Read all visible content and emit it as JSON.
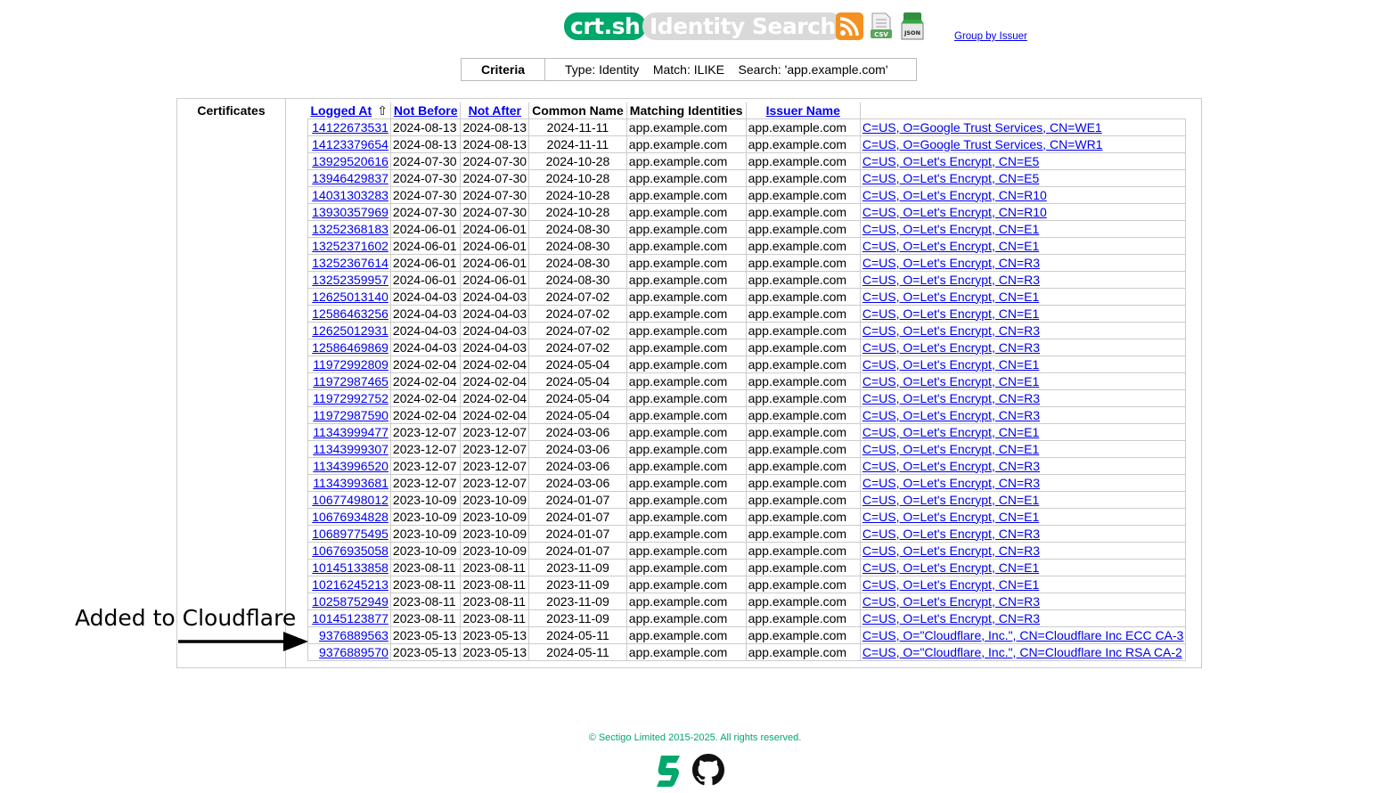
{
  "header": {
    "brand": "crt.sh",
    "subtitle": "Identity Search",
    "group_link": "Group by Issuer",
    "icons": [
      "rss-feed-icon",
      "csv-icon",
      "json-icon"
    ]
  },
  "criteria": {
    "label": "Criteria",
    "text": "Type: Identity    Match: ILIKE    Search: 'app.example.com'"
  },
  "results": {
    "section_label": "Certificates",
    "columns": [
      "Logged At",
      "Not Before",
      "Not After",
      "Common Name",
      "Matching Identities",
      "Issuer Name"
    ],
    "sort_arrow": "⇧",
    "rows": [
      [
        "14122673531",
        "2024-08-13",
        "2024-08-13",
        "2024-11-11",
        "app.example.com",
        "app.example.com",
        "C=US, O=Google Trust Services, CN=WE1"
      ],
      [
        "14123379654",
        "2024-08-13",
        "2024-08-13",
        "2024-11-11",
        "app.example.com",
        "app.example.com",
        "C=US, O=Google Trust Services, CN=WR1"
      ],
      [
        "13929520616",
        "2024-07-30",
        "2024-07-30",
        "2024-10-28",
        "app.example.com",
        "app.example.com",
        "C=US, O=Let's Encrypt, CN=E5"
      ],
      [
        "13946429837",
        "2024-07-30",
        "2024-07-30",
        "2024-10-28",
        "app.example.com",
        "app.example.com",
        "C=US, O=Let's Encrypt, CN=E5"
      ],
      [
        "14031303283",
        "2024-07-30",
        "2024-07-30",
        "2024-10-28",
        "app.example.com",
        "app.example.com",
        "C=US, O=Let's Encrypt, CN=R10"
      ],
      [
        "13930357969",
        "2024-07-30",
        "2024-07-30",
        "2024-10-28",
        "app.example.com",
        "app.example.com",
        "C=US, O=Let's Encrypt, CN=R10"
      ],
      [
        "13252368183",
        "2024-06-01",
        "2024-06-01",
        "2024-08-30",
        "app.example.com",
        "app.example.com",
        "C=US, O=Let's Encrypt, CN=E1"
      ],
      [
        "13252371602",
        "2024-06-01",
        "2024-06-01",
        "2024-08-30",
        "app.example.com",
        "app.example.com",
        "C=US, O=Let's Encrypt, CN=E1"
      ],
      [
        "13252367614",
        "2024-06-01",
        "2024-06-01",
        "2024-08-30",
        "app.example.com",
        "app.example.com",
        "C=US, O=Let's Encrypt, CN=R3"
      ],
      [
        "13252359957",
        "2024-06-01",
        "2024-06-01",
        "2024-08-30",
        "app.example.com",
        "app.example.com",
        "C=US, O=Let's Encrypt, CN=R3"
      ],
      [
        "12625013140",
        "2024-04-03",
        "2024-04-03",
        "2024-07-02",
        "app.example.com",
        "app.example.com",
        "C=US, O=Let's Encrypt, CN=E1"
      ],
      [
        "12586463256",
        "2024-04-03",
        "2024-04-03",
        "2024-07-02",
        "app.example.com",
        "app.example.com",
        "C=US, O=Let's Encrypt, CN=E1"
      ],
      [
        "12625012931",
        "2024-04-03",
        "2024-04-03",
        "2024-07-02",
        "app.example.com",
        "app.example.com",
        "C=US, O=Let's Encrypt, CN=R3"
      ],
      [
        "12586469869",
        "2024-04-03",
        "2024-04-03",
        "2024-07-02",
        "app.example.com",
        "app.example.com",
        "C=US, O=Let's Encrypt, CN=R3"
      ],
      [
        "11972992809",
        "2024-02-04",
        "2024-02-04",
        "2024-05-04",
        "app.example.com",
        "app.example.com",
        "C=US, O=Let's Encrypt, CN=E1"
      ],
      [
        "11972987465",
        "2024-02-04",
        "2024-02-04",
        "2024-05-04",
        "app.example.com",
        "app.example.com",
        "C=US, O=Let's Encrypt, CN=E1"
      ],
      [
        "11972992752",
        "2024-02-04",
        "2024-02-04",
        "2024-05-04",
        "app.example.com",
        "app.example.com",
        "C=US, O=Let's Encrypt, CN=R3"
      ],
      [
        "11972987590",
        "2024-02-04",
        "2024-02-04",
        "2024-05-04",
        "app.example.com",
        "app.example.com",
        "C=US, O=Let's Encrypt, CN=R3"
      ],
      [
        "11343999477",
        "2023-12-07",
        "2023-12-07",
        "2024-03-06",
        "app.example.com",
        "app.example.com",
        "C=US, O=Let's Encrypt, CN=E1"
      ],
      [
        "11343999307",
        "2023-12-07",
        "2023-12-07",
        "2024-03-06",
        "app.example.com",
        "app.example.com",
        "C=US, O=Let's Encrypt, CN=E1"
      ],
      [
        "11343996520",
        "2023-12-07",
        "2023-12-07",
        "2024-03-06",
        "app.example.com",
        "app.example.com",
        "C=US, O=Let's Encrypt, CN=R3"
      ],
      [
        "11343993681",
        "2023-12-07",
        "2023-12-07",
        "2024-03-06",
        "app.example.com",
        "app.example.com",
        "C=US, O=Let's Encrypt, CN=R3"
      ],
      [
        "10677498012",
        "2023-10-09",
        "2023-10-09",
        "2024-01-07",
        "app.example.com",
        "app.example.com",
        "C=US, O=Let's Encrypt, CN=E1"
      ],
      [
        "10676934828",
        "2023-10-09",
        "2023-10-09",
        "2024-01-07",
        "app.example.com",
        "app.example.com",
        "C=US, O=Let's Encrypt, CN=E1"
      ],
      [
        "10689775495",
        "2023-10-09",
        "2023-10-09",
        "2024-01-07",
        "app.example.com",
        "app.example.com",
        "C=US, O=Let's Encrypt, CN=R3"
      ],
      [
        "10676935058",
        "2023-10-09",
        "2023-10-09",
        "2024-01-07",
        "app.example.com",
        "app.example.com",
        "C=US, O=Let's Encrypt, CN=R3"
      ],
      [
        "10145133858",
        "2023-08-11",
        "2023-08-11",
        "2023-11-09",
        "app.example.com",
        "app.example.com",
        "C=US, O=Let's Encrypt, CN=E1"
      ],
      [
        "10216245213",
        "2023-08-11",
        "2023-08-11",
        "2023-11-09",
        "app.example.com",
        "app.example.com",
        "C=US, O=Let's Encrypt, CN=E1"
      ],
      [
        "10258752949",
        "2023-08-11",
        "2023-08-11",
        "2023-11-09",
        "app.example.com",
        "app.example.com",
        "C=US, O=Let's Encrypt, CN=R3"
      ],
      [
        "10145123877",
        "2023-08-11",
        "2023-08-11",
        "2023-11-09",
        "app.example.com",
        "app.example.com",
        "C=US, O=Let's Encrypt, CN=R3"
      ],
      [
        "9376889563",
        "2023-05-13",
        "2023-05-13",
        "2024-05-11",
        "app.example.com",
        "app.example.com",
        "C=US, O=\"Cloudflare, Inc.\", CN=Cloudflare Inc ECC CA-3"
      ],
      [
        "9376889570",
        "2023-05-13",
        "2023-05-13",
        "2024-05-11",
        "app.example.com",
        "app.example.com",
        "C=US, O=\"Cloudflare, Inc.\", CN=Cloudflare Inc RSA CA-2"
      ]
    ]
  },
  "annotation": {
    "text": "Added to Cloudflare"
  },
  "footer": {
    "copyright": "© Sectigo Limited 2015-2025. All rights reserved.",
    "icons": [
      "sectigo-logo-icon",
      "github-icon"
    ]
  },
  "colors": {
    "brand_green": "#00a86b",
    "subtitle_grey": "#d9d9d9",
    "link_blue": "#0000ee",
    "rss_orange": "#f39222",
    "border_grey": "#cccccc"
  }
}
